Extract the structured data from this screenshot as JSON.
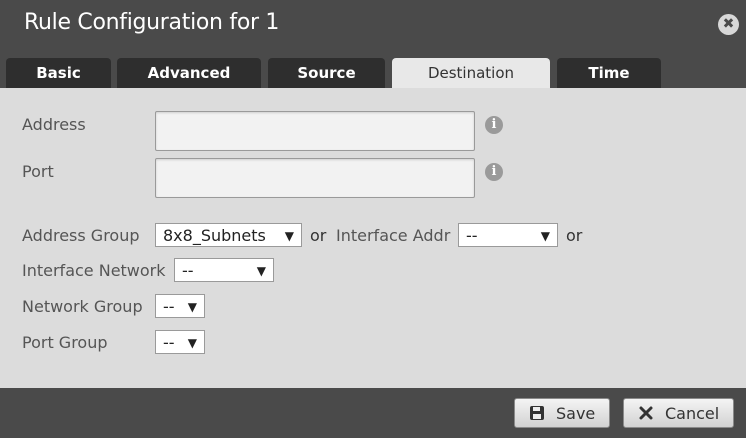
{
  "dialog": {
    "title": "Rule Configuration for 1",
    "close_glyph": "✖"
  },
  "tabs": [
    {
      "label": "Basic",
      "active": false
    },
    {
      "label": "Advanced",
      "active": false
    },
    {
      "label": "Source",
      "active": false
    },
    {
      "label": "Destination",
      "active": true
    },
    {
      "label": "Time",
      "active": false
    }
  ],
  "form": {
    "address": {
      "label": "Address",
      "value": "",
      "info_icon": "i"
    },
    "port": {
      "label": "Port",
      "value": "",
      "info_icon": "i"
    },
    "address_group": {
      "label": "Address Group",
      "value": "8x8_Subnets"
    },
    "or_1": "or",
    "interface_addr": {
      "label": "Interface Addr",
      "value": "--"
    },
    "or_2": "or",
    "interface_network": {
      "label": "Interface Network",
      "value": "--"
    },
    "network_group": {
      "label": "Network Group",
      "value": "--"
    },
    "port_group": {
      "label": "Port Group",
      "value": "--"
    },
    "dropdown_arrow": "▼"
  },
  "footer": {
    "save_label": "Save",
    "cancel_label": "Cancel"
  },
  "icons": {
    "save": "floppy-disk-icon",
    "cancel": "x-icon",
    "info": "info-icon",
    "close": "close-icon"
  }
}
